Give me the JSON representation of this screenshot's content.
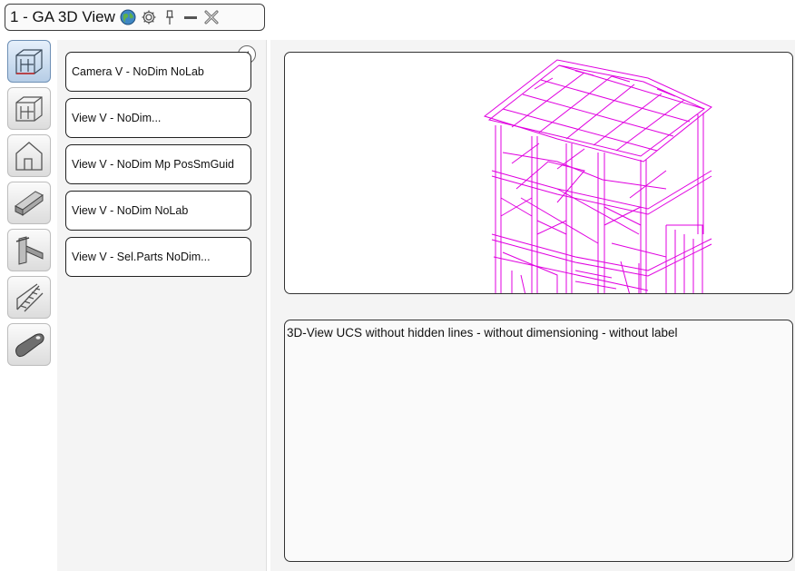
{
  "window": {
    "title": "1 - GA 3D View"
  },
  "titlebar_icons": [
    "globe-icon",
    "gear-icon",
    "pin-icon",
    "minimize-icon",
    "close-icon"
  ],
  "tools": [
    {
      "name": "view-3d-camera-tool",
      "icon": "camera-frame-icon",
      "active": true
    },
    {
      "name": "view-3d-frame-tool",
      "icon": "frame-outline-icon",
      "active": false
    },
    {
      "name": "house-elevation-tool",
      "icon": "house-icon",
      "active": false
    },
    {
      "name": "beam-profile-tool",
      "icon": "beam-icon",
      "active": false
    },
    {
      "name": "column-connection-tool",
      "icon": "column-icon",
      "active": false
    },
    {
      "name": "stair-tool",
      "icon": "stair-icon",
      "active": false
    },
    {
      "name": "part-tool",
      "icon": "plate-icon",
      "active": false
    }
  ],
  "views": [
    {
      "label": "Camera V - NoDim NoLab"
    },
    {
      "label": "View V - NoDim..."
    },
    {
      "label": "View V - NoDim Mp PosSmGuid"
    },
    {
      "label": "View V - NoDim NoLab"
    },
    {
      "label": "View V - Sel.Parts NoDim..."
    }
  ],
  "description": "3D-View UCS without hidden lines - without dimensioning - without label",
  "colors": {
    "wireframe": "#e000e0",
    "accent_active": "#9bbbe0"
  }
}
